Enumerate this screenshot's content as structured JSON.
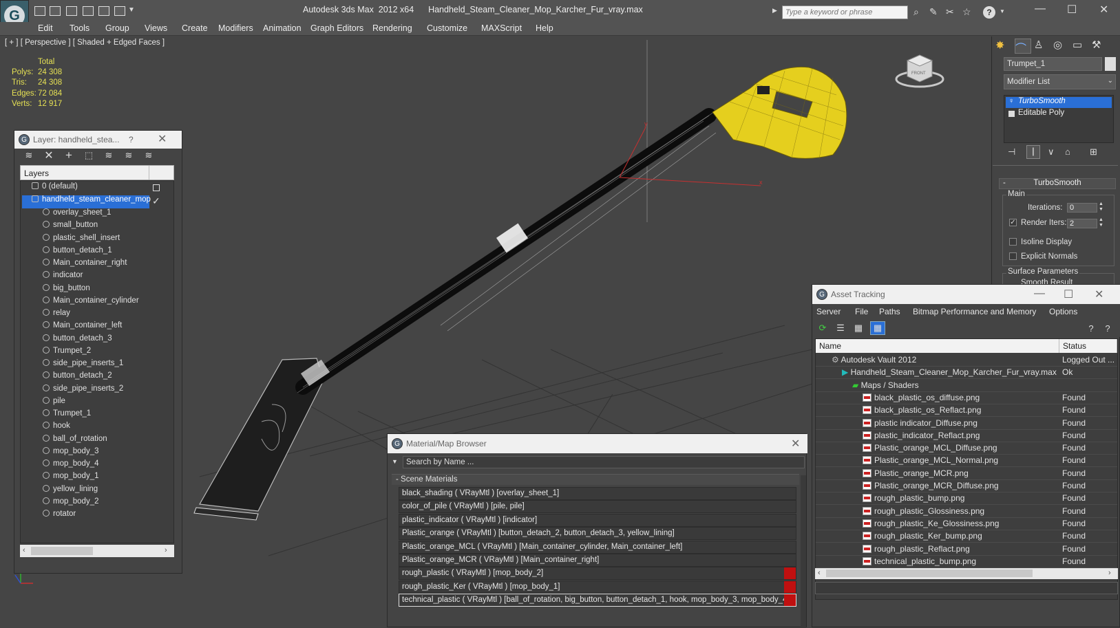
{
  "titlebar": {
    "app_name": "Autodesk 3ds Max  2012 x64",
    "file_name": "Handheld_Steam_Cleaner_Mop_Karcher_Fur_vray.max",
    "search_placeholder": "Type a keyword or phrase"
  },
  "menu": [
    "Edit",
    "Tools",
    "Group",
    "Views",
    "Create",
    "Modifiers",
    "Animation",
    "Graph Editors",
    "Rendering",
    "Customize",
    "MAXScript",
    "Help"
  ],
  "viewport": {
    "label": "[ + ] [ Perspective ] [ Shaded + Edged Faces ]",
    "stats_header": "Total",
    "stats": [
      {
        "label": "Polys:",
        "value": "24 308"
      },
      {
        "label": "Tris:",
        "value": "24 308"
      },
      {
        "label": "Edges:",
        "value": "72 084"
      },
      {
        "label": "Verts:",
        "value": "12 917"
      }
    ],
    "viewcube_label": "FRONT",
    "colors": {
      "background": "#454545",
      "mesh_yellow": "#e5cf1e",
      "wire": "#ffffff",
      "axis_red": "#d03030"
    }
  },
  "layer_panel": {
    "title": "Layer: handheld_stea...",
    "help": "?",
    "list_header": "Layers",
    "default_layer": "0 (default)",
    "active_layer": "handheld_steam_cleaner_mop",
    "objects": [
      "overlay_sheet_1",
      "small_button",
      "plastic_shell_insert",
      "button_detach_1",
      "Main_container_right",
      "indicator",
      "big_button",
      "Main_container_cylinder",
      "relay",
      "Main_container_left",
      "button_detach_3",
      "Trumpet_2",
      "side_pipe_inserts_1",
      "button_detach_2",
      "side_pipe_inserts_2",
      "pile",
      "Trumpet_1",
      "hook",
      "ball_of_rotation",
      "mop_body_3",
      "mop_body_4",
      "mop_body_1",
      "yellow_lining",
      "mop_body_2",
      "rotator"
    ]
  },
  "command_panel": {
    "object_name": "Trumpet_1",
    "modifier_list": "Modifier List",
    "stack": [
      "TurboSmooth",
      "Editable Poly"
    ],
    "rollout_title": "TurboSmooth",
    "main_group": "Main",
    "iterations_label": "Iterations:",
    "iterations_value": "0",
    "render_iters_label": "Render Iters:",
    "render_iters_value": "2",
    "isoline_label": "Isoline Display",
    "explicit_normals_label": "Explicit Normals",
    "surface_params_label": "Surface Parameters",
    "smooth_result_label": "Smooth Result"
  },
  "asset_tracking": {
    "title": "Asset Tracking",
    "menu": [
      "Server",
      "File",
      "Paths",
      "Bitmap Performance and Memory",
      "Options"
    ],
    "col_name": "Name",
    "col_status": "Status",
    "rows": [
      {
        "name": "Autodesk Vault 2012",
        "status": "Logged Out ...",
        "indent": 1,
        "icon": "vault"
      },
      {
        "name": "Handheld_Steam_Cleaner_Mop_Karcher_Fur_vray.max",
        "status": "Ok",
        "indent": 2,
        "icon": "max"
      },
      {
        "name": "Maps / Shaders",
        "status": "",
        "indent": 3,
        "icon": "maps"
      },
      {
        "name": "black_plastic_os_diffuse.png",
        "status": "Found",
        "indent": 4,
        "icon": "png"
      },
      {
        "name": "black_plastic_os_Reflact.png",
        "status": "Found",
        "indent": 4,
        "icon": "png"
      },
      {
        "name": "plastic indicator_Diffuse.png",
        "status": "Found",
        "indent": 4,
        "icon": "png"
      },
      {
        "name": "plastic_indicator_Reflact.png",
        "status": "Found",
        "indent": 4,
        "icon": "png"
      },
      {
        "name": "Plastic_orange_MCL_Diffuse.png",
        "status": "Found",
        "indent": 4,
        "icon": "png"
      },
      {
        "name": "Plastic_orange_MCL_Normal.png",
        "status": "Found",
        "indent": 4,
        "icon": "png"
      },
      {
        "name": "Plastic_orange_MCR.png",
        "status": "Found",
        "indent": 4,
        "icon": "png"
      },
      {
        "name": "Plastic_orange_MCR_Diffuse.png",
        "status": "Found",
        "indent": 4,
        "icon": "png"
      },
      {
        "name": "rough_plastic_bump.png",
        "status": "Found",
        "indent": 4,
        "icon": "png"
      },
      {
        "name": "rough_plastic_Glossiness.png",
        "status": "Found",
        "indent": 4,
        "icon": "png"
      },
      {
        "name": "rough_plastic_Ke_Glossiness.png",
        "status": "Found",
        "indent": 4,
        "icon": "png"
      },
      {
        "name": "rough_plastic_Ker_bump.png",
        "status": "Found",
        "indent": 4,
        "icon": "png"
      },
      {
        "name": "rough_plastic_Reflact.png",
        "status": "Found",
        "indent": 4,
        "icon": "png"
      },
      {
        "name": "technical_plastic_bump.png",
        "status": "Found",
        "indent": 4,
        "icon": "png"
      }
    ]
  },
  "material_browser": {
    "title": "Material/Map Browser",
    "search_placeholder": "Search by Name ...",
    "section": "- Scene Materials",
    "materials": [
      {
        "text": "black_shading  ( VRayMtl )  [overlay_sheet_1]",
        "flag": false
      },
      {
        "text": "color_of_pile  ( VRayMtl )  [pile, pile]",
        "flag": false
      },
      {
        "text": "plastic_indicator  ( VRayMtl )  [indicator]",
        "flag": false
      },
      {
        "text": "Plastic_orange  ( VRayMtl )  [button_detach_2, button_detach_3, yellow_lining]",
        "flag": false
      },
      {
        "text": "Plastic_orange_MCL  ( VRayMtl )  [Main_container_cylinder, Main_container_left]",
        "flag": false
      },
      {
        "text": "Plastic_orange_MCR  ( VRayMtl )  [Main_container_right]",
        "flag": false
      },
      {
        "text": "rough_plastic  ( VRayMtl )  [mop_body_2]",
        "flag": true
      },
      {
        "text": "rough_plastic_Ker  ( VRayMtl )  [mop_body_1]",
        "flag": true
      },
      {
        "text": "technical_plastic ( VRayMtl ) [ball_of_rotation, big_button, button_detach_1, hook, mop_body_3, mop_body_4...",
        "flag": true
      }
    ]
  }
}
